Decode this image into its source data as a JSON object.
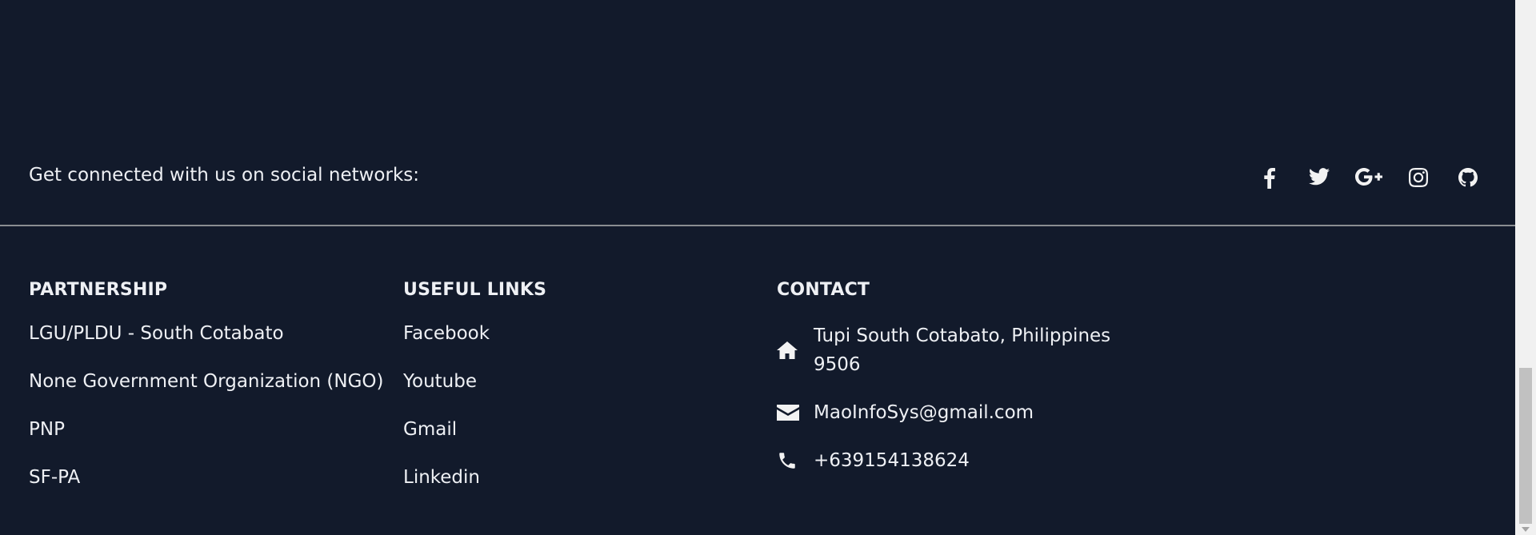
{
  "social": {
    "tagline": "Get connected with us on social networks:",
    "icons": [
      "facebook-icon",
      "twitter-icon",
      "google-plus-icon",
      "instagram-icon",
      "github-icon"
    ]
  },
  "partnership": {
    "title": "PARTNERSHIP",
    "items": [
      "LGU/PLDU - South Cotabato",
      "None Government Organization (NGO)",
      "PNP",
      "SF-PA"
    ]
  },
  "useful_links": {
    "title": "USEFUL LINKS",
    "items": [
      "Facebook",
      "Youtube",
      "Gmail",
      "Linkedin"
    ]
  },
  "contact": {
    "title": "CONTACT",
    "address_line1": "Tupi South Cotabato, Philippines",
    "address_line2": "9506",
    "email": "MaoInfoSys@gmail.com",
    "phone": "+639154138624"
  },
  "colors": {
    "background": "#121a2b",
    "text": "#eef0f4",
    "divider": "#8a8d92"
  }
}
